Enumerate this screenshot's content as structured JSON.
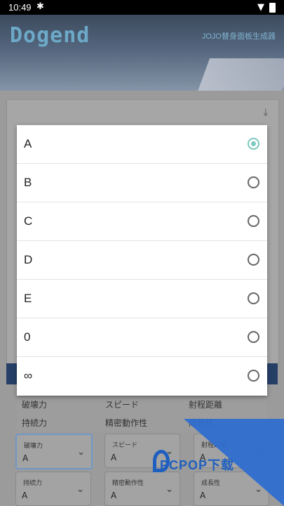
{
  "status": {
    "time": "10:49",
    "notif_icon": "android-debug-icon"
  },
  "header": {
    "logo": "Dogend",
    "subtitle": "JOJO替身面板生成器"
  },
  "table": {
    "row1": [
      "破壊力",
      "スピード",
      "射程距離"
    ],
    "row2": [
      "持続力",
      "精密動作性",
      "成長性"
    ]
  },
  "selects": [
    {
      "label": "破壊力",
      "value": "A"
    },
    {
      "label": "スピード",
      "value": "A"
    },
    {
      "label": "射程距離",
      "value": "A"
    },
    {
      "label": "持続力",
      "value": "A"
    },
    {
      "label": "精密動作性",
      "value": "A"
    },
    {
      "label": "成長性",
      "value": "A"
    }
  ],
  "dialog": {
    "options": [
      "A",
      "B",
      "C",
      "D",
      "E",
      "0",
      "∞"
    ],
    "selected": "A",
    "accent": "#7dc8c0"
  },
  "watermark": {
    "text": "PCPOP下载"
  }
}
